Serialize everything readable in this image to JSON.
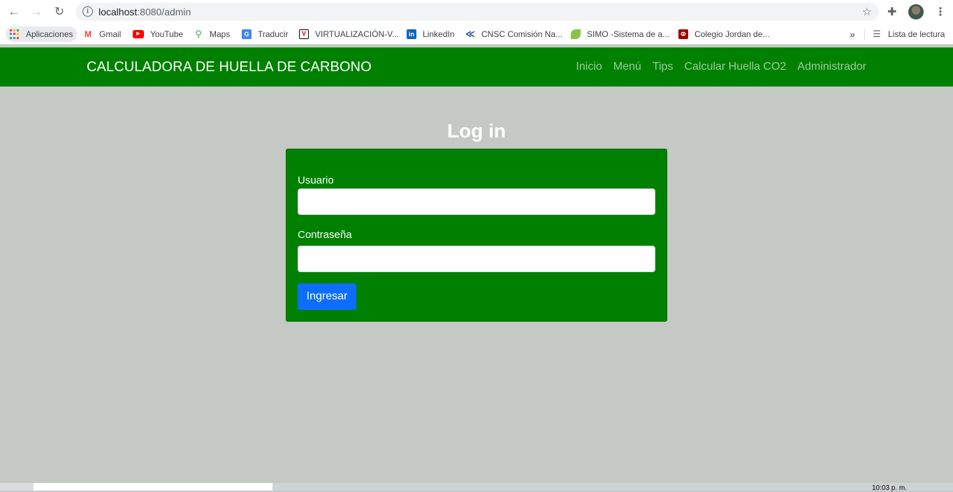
{
  "browser": {
    "url_host": "localhost",
    "url_rest": ":8080/admin",
    "bookmarks": [
      {
        "label": "Aplicaciones",
        "icon": "apps-grid-icon"
      },
      {
        "label": "Gmail",
        "icon": "gmail-icon"
      },
      {
        "label": "YouTube",
        "icon": "youtube-icon"
      },
      {
        "label": "Maps",
        "icon": "maps-icon"
      },
      {
        "label": "Traducir",
        "icon": "translate-icon"
      },
      {
        "label": "VIRTUALIZACIÓN-V...",
        "icon": "virtualizacion-icon"
      },
      {
        "label": "LinkedIn",
        "icon": "linkedin-icon"
      },
      {
        "label": "CNSC Comisión Na...",
        "icon": "cnsc-icon"
      },
      {
        "label": "SIMO -Sistema de a...",
        "icon": "simo-icon"
      },
      {
        "label": "Colegio Jordan de...",
        "icon": "colegio-icon"
      }
    ],
    "more_bookmarks": "»",
    "reading_list": "Lista de lectura"
  },
  "navbar": {
    "brand": "CALCULADORA DE HUELLA DE CARBONO",
    "links": [
      "Inicio",
      "Menú",
      "Tips",
      "Calcular Huella CO2",
      "Administrador"
    ]
  },
  "login": {
    "title": "Log in",
    "username_label": "Usuario",
    "username_value": "",
    "password_label": "Contraseña",
    "password_value": "",
    "submit_label": "Ingresar"
  },
  "taskbar": {
    "time": "10:03 p. m."
  },
  "colors": {
    "navbar_bg": "#008000",
    "page_bg": "#c5c9c4",
    "button_bg": "#0d6efd"
  }
}
